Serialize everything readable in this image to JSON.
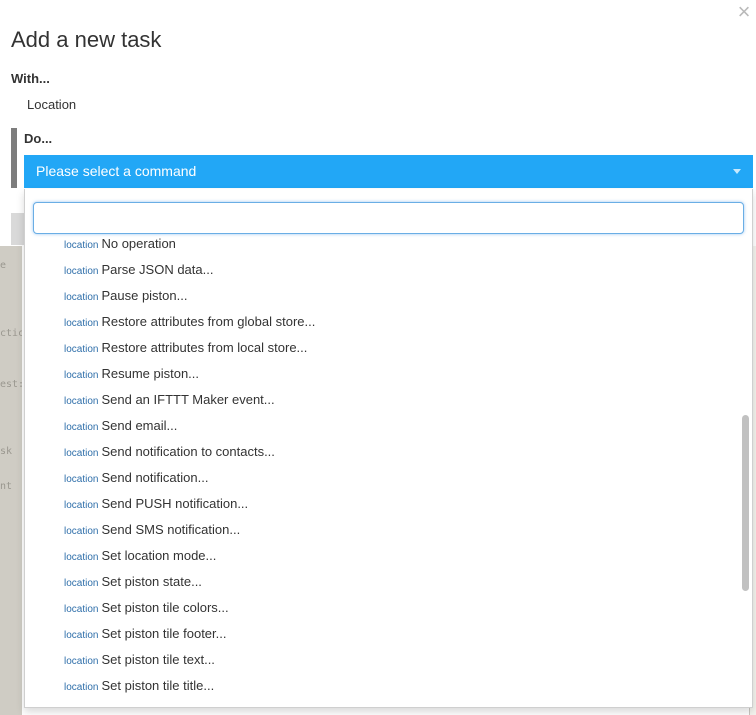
{
  "dialog": {
    "title": "Add a new task",
    "close_glyph": "×",
    "with_label": "With...",
    "with_value": "Location",
    "do_label": "Do...",
    "select_placeholder": "Please select a command"
  },
  "dropdown": {
    "search_value": "",
    "tag": "location",
    "options": [
      "No operation",
      "Parse JSON data...",
      "Pause piston...",
      "Restore attributes from global store...",
      "Restore attributes from local store...",
      "Resume piston...",
      "Send an IFTTT Maker event...",
      "Send email...",
      "Send notification to contacts...",
      "Send notification...",
      "Send PUSH notification...",
      "Send SMS notification...",
      "Set location mode...",
      "Set piston state...",
      "Set piston tile colors...",
      "Set piston tile footer...",
      "Set piston tile text...",
      "Set piston tile title..."
    ]
  },
  "colors": {
    "select_bar": "#22a7f6",
    "tag": "#2f6faa",
    "do_marker": "#7d7d7d"
  }
}
